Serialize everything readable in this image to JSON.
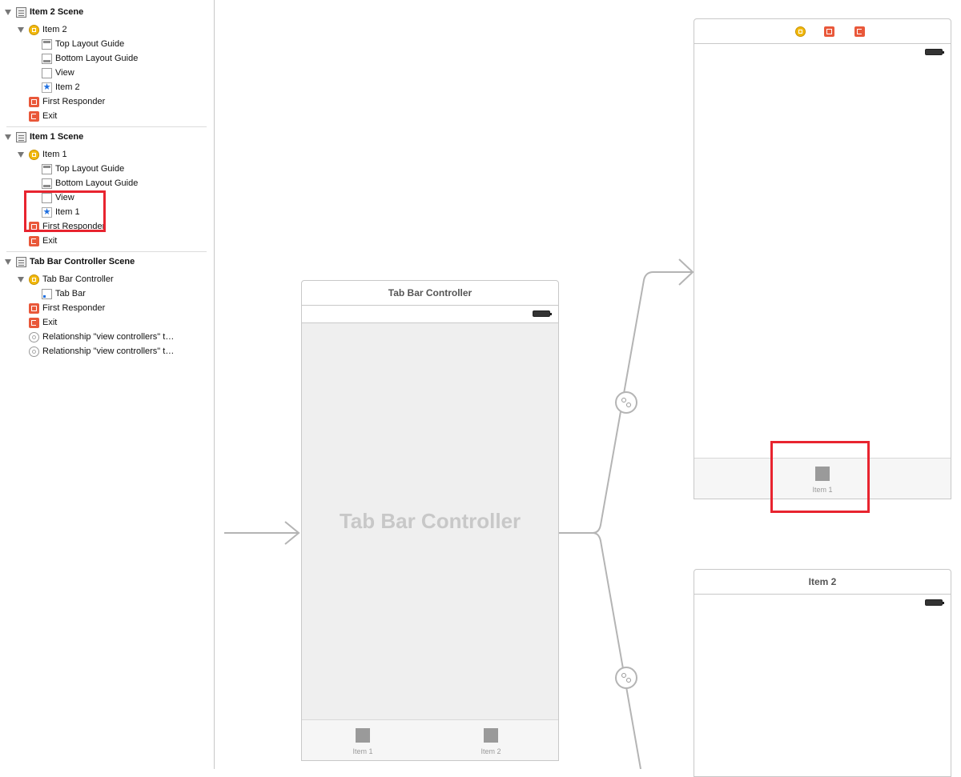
{
  "outline": {
    "item2_scene": {
      "title": "Item 2 Scene",
      "vc": "Item 2",
      "children": [
        "Top Layout Guide",
        "Bottom Layout Guide",
        "View",
        "Item 2"
      ],
      "first_responder": "First Responder",
      "exit": "Exit"
    },
    "item1_scene": {
      "title": "Item 1 Scene",
      "vc": "Item 1",
      "children": [
        "Top Layout Guide",
        "Bottom Layout Guide",
        "View",
        "Item 1"
      ],
      "first_responder": "First Responder",
      "exit": "Exit"
    },
    "tab_scene": {
      "title": "Tab Bar Controller Scene",
      "vc": "Tab Bar Controller",
      "tab_bar": "Tab Bar",
      "first_responder": "First Responder",
      "exit": "Exit",
      "relationships": [
        "Relationship \"view controllers\" t…",
        "Relationship \"view controllers\" t…"
      ]
    }
  },
  "canvas": {
    "tab_controller": {
      "title": "Tab Bar Controller",
      "placeholder": "Tab Bar Controller",
      "tabs": [
        "Item 1",
        "Item 2"
      ]
    },
    "item1_controller": {
      "tab": "Item 1"
    },
    "item2_controller": {
      "title": "Item 2"
    }
  },
  "colors": {
    "highlight": "#e8242f",
    "vc_icon": "#f2b90e",
    "responder_icon": "#e9583a",
    "segue_line": "#b4b4b4"
  }
}
